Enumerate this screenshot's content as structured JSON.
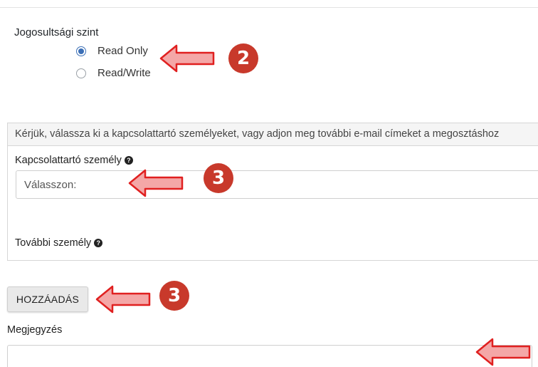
{
  "permission": {
    "label": "Jogosultsági szint",
    "options": [
      {
        "label": "Read Only",
        "selected": true
      },
      {
        "label": "Read/Write",
        "selected": false
      }
    ]
  },
  "contacts": {
    "header": "Kérjük, válassza ki a kapcsolattartó személyeket, vagy adjon meg további e-mail címeket a megosztáshoz",
    "contact_label": "Kapcsolattartó személy",
    "contact_placeholder": "Válasszon:",
    "extra_label": "További személy"
  },
  "add_button": {
    "label": "HOZZÁADÁS"
  },
  "notes": {
    "label": "Megjegyzés"
  },
  "annotations": [
    {
      "number": "2"
    },
    {
      "number": "3"
    },
    {
      "number": "3"
    }
  ],
  "icons": {
    "help": "question-circle-icon",
    "arrow": "left-arrow-icon"
  },
  "colors": {
    "badge": "#c8392b",
    "arrow_fill": "#f4a7a7",
    "arrow_stroke": "#e02020",
    "radio_checked": "#3b6fb6"
  }
}
